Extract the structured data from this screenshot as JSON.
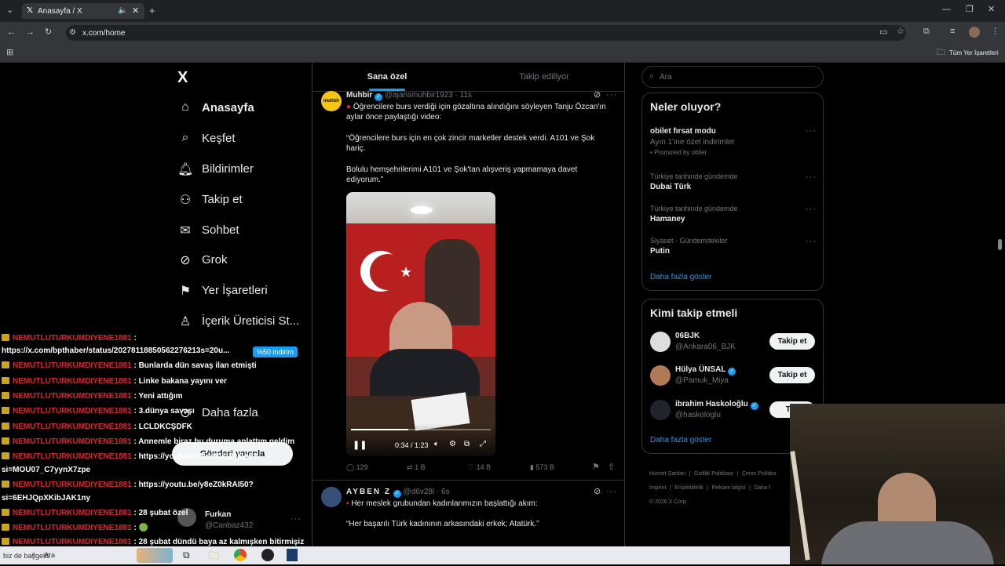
{
  "browser": {
    "tab_title": "Anasayfa / X",
    "url": "x.com/home",
    "bookmarks_label": "Tüm Yer İşaretleri"
  },
  "nav": {
    "logo": "X",
    "items": [
      {
        "label": "Anasayfa",
        "icon": "home-icon"
      },
      {
        "label": "Keşfet",
        "icon": "search-icon"
      },
      {
        "label": "Bildirimler",
        "icon": "bell-icon"
      },
      {
        "label": "Takip et",
        "icon": "add-user-icon"
      },
      {
        "label": "Sohbet",
        "icon": "mail-icon"
      },
      {
        "label": "Grok",
        "icon": "grok-icon"
      },
      {
        "label": "Yer İşaretleri",
        "icon": "bookmark-icon"
      },
      {
        "label": "İçerik Üreticisi St...",
        "icon": "creator-icon"
      },
      {
        "label": "Daha fazla",
        "icon": "more-icon"
      }
    ],
    "discount_badge": "%50 indirim",
    "post_button": "Gönderi yayınla",
    "account": {
      "name": "Furkan",
      "handle": "@Canbaz432"
    }
  },
  "feed": {
    "tabs": [
      "Sana özel",
      "Takip ediliyor"
    ],
    "tweet1": {
      "name": "Muhbir",
      "handle": "@ajansmuhbir1923 · 11s",
      "line1": "Öğrencilere burs verdiği için gözaltına alındığını söyleyen Tanju Özcan'ın",
      "line2": "aylar önce paylaştığı video:",
      "quote1": "“Öğrencilere burs için en çok zincir marketler destek verdi. A101 ve Şok",
      "quote2": "hariç.",
      "quote3": "Bolulu hemşehrilerimi A101 ve Şok'tan alışveriş yapmamaya davet",
      "quote4": "ediyorum.”",
      "video_time": "0:34 / 1:23",
      "replies": "129",
      "reposts": "1 B",
      "likes": "14 B",
      "views": "573 B",
      "avatar_text": "muhbir"
    },
    "tweet2": {
      "name": "AYBEN Z",
      "handle": "@d6v28l · 6s",
      "line1": "Her meslek grubundan kadınlarımızın başlattığı akım:",
      "quote1": "“Her başarılı Türk kadınının arkasındaki erkek; Atatürk.”"
    }
  },
  "sidebar": {
    "search_placeholder": "Ara",
    "trends_title": "Neler oluyor?",
    "trends": [
      {
        "context": "",
        "title": "obilet fırsat modu",
        "sub": "Ayın 1'ine özel indirimler",
        "promo": "Promoted by obilet"
      },
      {
        "context": "Türkiye tarihinde gündemde",
        "title": "Dubai Türk"
      },
      {
        "context": "Türkiye tarihinde gündemde",
        "title": "Hamaney"
      },
      {
        "context": "Siyaset · Gündemdekiler",
        "title": "Putin"
      }
    ],
    "show_more": "Daha fazla göster",
    "who_title": "Kimi takip etmeli",
    "who": [
      {
        "name": "06BJK",
        "handle": "@Ankara06_BJK"
      },
      {
        "name": "Hülya ÜNSAL",
        "handle": "@Pamuk_Miya"
      },
      {
        "name": "ibrahim Haskoloğlu",
        "handle": "@haskologlu"
      }
    ],
    "follow_label": "Takip et",
    "follow_label_cut": "Tak",
    "show_more2": "Daha fazla göster",
    "footer": [
      "Hizmet Şartları",
      "Gizlilik Politikası",
      "Çerez Politika",
      "Imprint",
      "Erişilebilirlik",
      "Reklam bilgisi",
      "Daha f"
    ],
    "copyright": "© 2026 X Corp."
  },
  "chat": {
    "user": "NEMUTLUTURKUMDIYENE1881",
    "lines": [
      ":",
      "https://x.com/bpthaber/status/20278118850562276213s=20u...",
      ": Bunlarda dün savaş ilan etmişti",
      ": Linke bakana yayını ver",
      ": Yeni attığım",
      ": 3.dünya savaşı",
      ": LCLDKCŞDFK",
      ": Annemle biraz bu duruma anlattım geldim",
      ": https://youtu.be/Ndd8U12U2d8?",
      "si=MOU07_C7yynX7zpe",
      ": https://youtu.be/y8eZ0kRAI50?",
      "si=6EHJQpXKibJAK1ny",
      ": 28 şubat özel",
      ": 🟢",
      ": 28 şubat dündü baya az kalmışken bitirmişiz"
    ],
    "footer": "biz de başgeldi"
  },
  "taskbar": {
    "search": "Ara"
  }
}
